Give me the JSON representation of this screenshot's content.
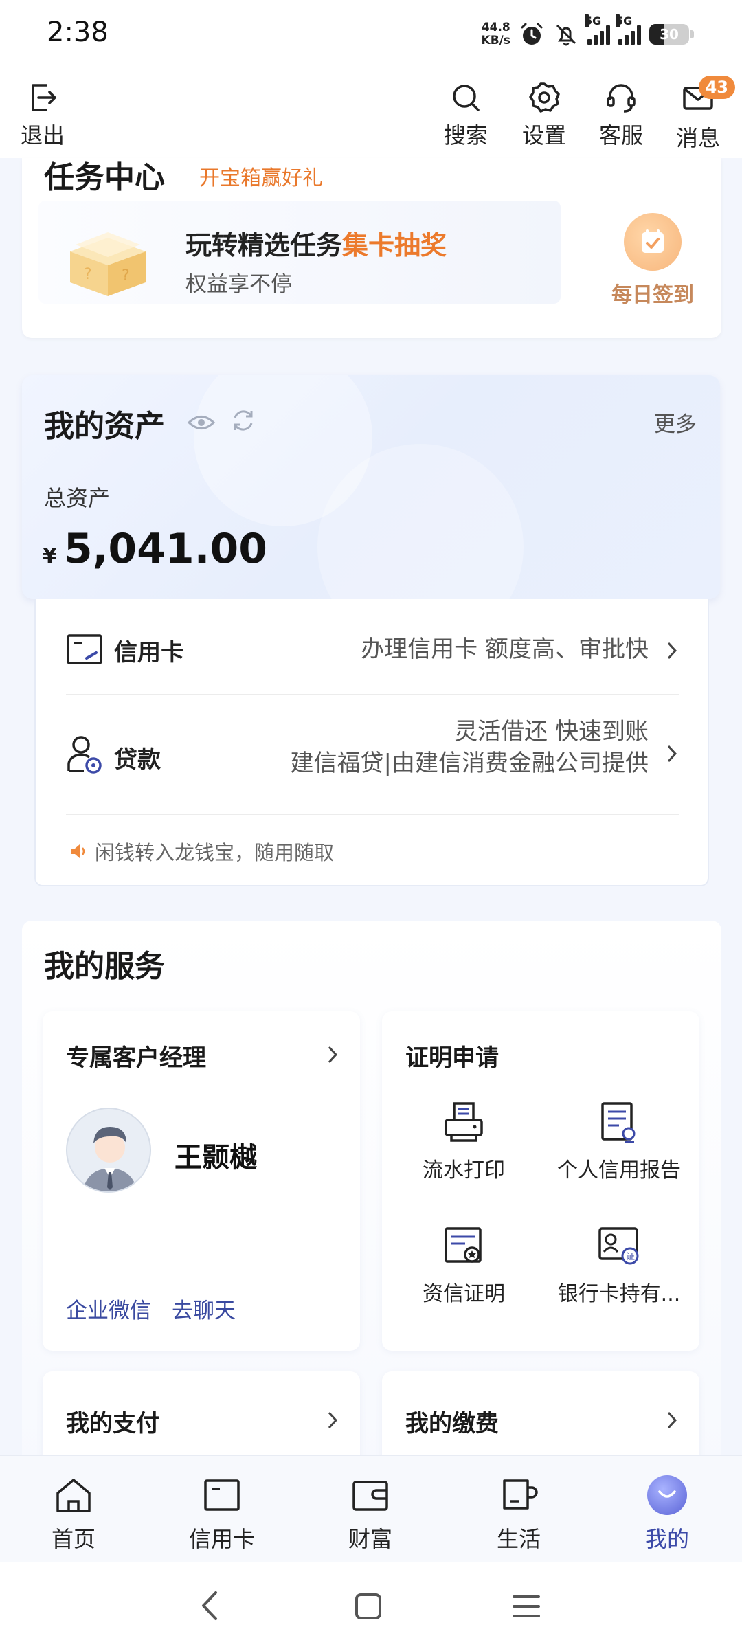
{
  "status_bar": {
    "time": "2:38",
    "net_speed_value": "44.8",
    "net_speed_unit": "KB/s",
    "signal_1": "5G",
    "signal_2": "5G",
    "battery": "30"
  },
  "top_nav": {
    "logout": "退出",
    "search": "搜索",
    "settings": "设置",
    "service": "客服",
    "messages": "消息",
    "message_badge": "43"
  },
  "task_center": {
    "title": "任务中心",
    "subtitle": "开宝箱赢好礼",
    "promo_main": "玩转精选任务",
    "promo_highlight": "集卡抽奖",
    "promo_desc": "权益享不停",
    "checkin": "每日签到"
  },
  "assets": {
    "title": "我的资产",
    "more": "更多",
    "total_label": "总资产",
    "currency": "¥",
    "total_value": "5,041.00"
  },
  "asset_services": [
    {
      "title": "信用卡",
      "desc": [
        "办理信用卡 额度高、审批快"
      ]
    },
    {
      "title": "贷款",
      "desc": [
        "灵活借还 快速到账",
        "建信福贷|由建信消费金融公司提供"
      ]
    }
  ],
  "tip": "闲钱转入龙钱宝，随用随取",
  "my_services": {
    "title": "我的服务",
    "manager": {
      "title": "专属客户经理",
      "name": "王颢樾",
      "link_1": "企业微信",
      "link_2": "去聊天"
    },
    "certificate": {
      "title": "证明申请",
      "items": [
        "流水打印",
        "个人信用报告",
        "资信证明",
        "银行卡持有..."
      ]
    },
    "payment": "我的支付",
    "fees": "我的缴费"
  },
  "tab_bar": {
    "tabs": [
      "首页",
      "信用卡",
      "财富",
      "生活",
      "我的"
    ],
    "active": "我的",
    "active_color": "#3c4aa8"
  },
  "colors": {
    "accent_orange": "#ec7a2c",
    "link_blue": "#3a4aa0",
    "badge": "#f08a3c"
  }
}
